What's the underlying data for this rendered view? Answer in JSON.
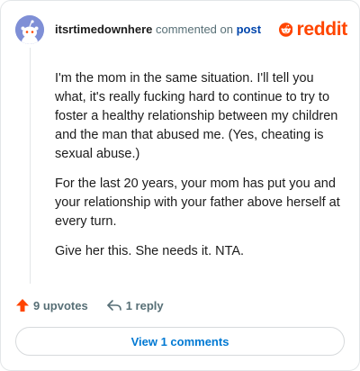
{
  "comment": {
    "username": "itsrtimedownhere",
    "action_text": "commented on",
    "post_link": "post",
    "avatar_icon": "reddit-snoo-avatar-icon",
    "paragraphs": [
      "I'm the mom in the same situation. I'll tell you what, it's really fucking hard to continue to try to foster a healthy relationship between my children and the man that abused me. (Yes, cheating is sexual abuse.)",
      "For the last 20 years, your mom has put you and your relationship with your father above herself at every turn.",
      "Give her this. She needs it. NTA."
    ]
  },
  "brand": {
    "name": "reddit",
    "color": "#ff4500",
    "icon": "reddit-logo-icon"
  },
  "actions": {
    "upvotes": "9 upvotes",
    "upvote_icon": "upvote-arrow-icon",
    "replies": "1 reply",
    "reply_icon": "reply-arrow-icon"
  },
  "footer": {
    "view_comments": "View 1 comments"
  },
  "colors": {
    "upvote": "#ff4500",
    "link": "#0079d3",
    "post_link": "#0045ac"
  }
}
